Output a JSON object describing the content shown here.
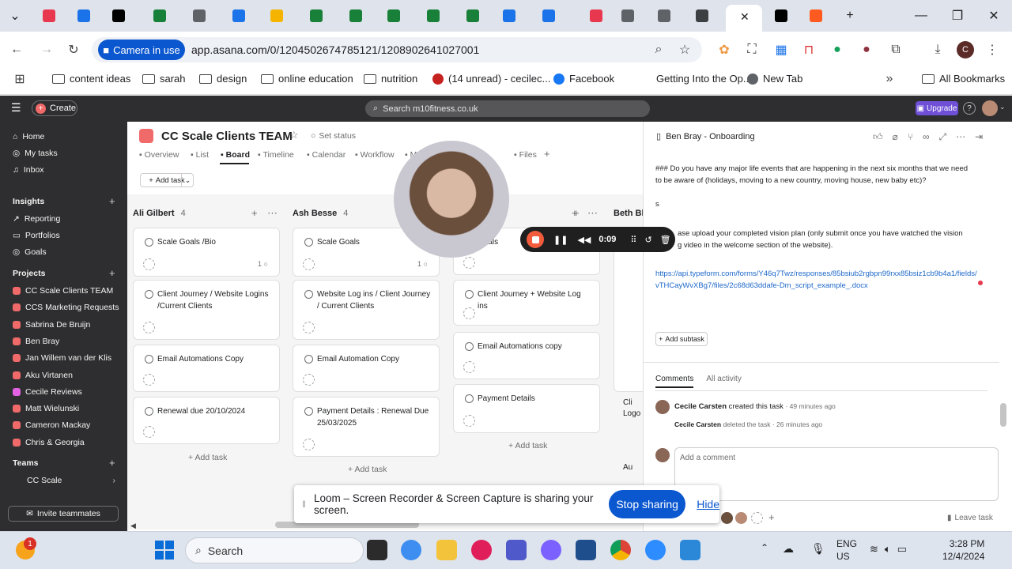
{
  "browser": {
    "url": "app.asana.com/0/1204502674785121/1208902641027001",
    "camera_label": "Camera in use",
    "bookmarks": [
      "content ideas",
      "sarah",
      "design",
      "online education",
      "nutrition",
      "(14 unread) - cecilec...",
      "Facebook",
      "Getting Into the Op...",
      "New Tab"
    ],
    "all_bookmarks": "All Bookmarks"
  },
  "asana": {
    "create_label": "Create",
    "search_placeholder": "Search m10fitness.co.uk",
    "upgrade_label": "Upgrade",
    "help_label": "?"
  },
  "sidebar": {
    "nav": [
      "Home",
      "My tasks",
      "Inbox"
    ],
    "insights_header": "Insights",
    "insights": [
      "Reporting",
      "Portfolios",
      "Goals"
    ],
    "projects_header": "Projects",
    "projects": [
      {
        "name": "CC Scale Clients TEAM",
        "color": "#f06a6a"
      },
      {
        "name": "CCS Marketing Requests",
        "color": "#f06a6a"
      },
      {
        "name": "Sabrina De Bruijn",
        "color": "#f06a6a"
      },
      {
        "name": "Ben Bray",
        "color": "#f06a6a"
      },
      {
        "name": "Jan Willem van der Klis",
        "color": "#f06a6a"
      },
      {
        "name": "Aku Virtanen",
        "color": "#f06a6a"
      },
      {
        "name": "Cecile Reviews",
        "color": "#e362e3"
      },
      {
        "name": "Matt Wielunski",
        "color": "#f06a6a"
      },
      {
        "name": "Cameron Mackay",
        "color": "#f06a6a"
      },
      {
        "name": "Chris & Georgia",
        "color": "#f06a6a"
      }
    ],
    "teams_header": "Teams",
    "teams": [
      "CC Scale"
    ],
    "invite_label": "Invite teammates"
  },
  "project": {
    "title": "CC Scale Clients TEAM",
    "status": "Set status",
    "tabs": [
      "Overview",
      "List",
      "Board",
      "Timeline",
      "Calendar",
      "Workflow",
      "Messages",
      "Files"
    ],
    "add_task": "Add task"
  },
  "board": {
    "columns": [
      {
        "name": "Ali Gilbert",
        "count": "4",
        "cards": [
          {
            "title": "Scale Goals /Bio",
            "comments": "1"
          },
          {
            "title": "Client Journey / Website Logins /Current Clients",
            "comments": ""
          },
          {
            "title": "Email Automations Copy",
            "comments": ""
          },
          {
            "title": "Renewal due 20/10/2024",
            "comments": ""
          }
        ]
      },
      {
        "name": "Ash Besse",
        "count": "4",
        "cards": [
          {
            "title": "Scale Goals",
            "comments": "1"
          },
          {
            "title": "Website Log ins / Client Journey / Current Clients",
            "comments": ""
          },
          {
            "title": "Email Automation Copy",
            "comments": ""
          },
          {
            "title": "Payment Details : Renewal Due 25/03/2025",
            "comments": ""
          }
        ]
      },
      {
        "name": "",
        "count": "",
        "cards": [
          {
            "title": "Goals",
            "comments": ""
          },
          {
            "title": "Client Journey + Website Log ins",
            "comments": ""
          },
          {
            "title": "Email Automations copy",
            "comments": ""
          },
          {
            "title": "Payment Details",
            "comments": ""
          }
        ]
      },
      {
        "name": "Beth Bla",
        "count": "",
        "cards": [
          {
            "title": "Cli",
            "comments": ""
          },
          {
            "title": "Logo",
            "comments": ""
          },
          {
            "title": "Au",
            "comments": ""
          }
        ]
      }
    ],
    "add_task": "Add task"
  },
  "detail": {
    "title": "Ben Bray - Onboarding",
    "question": "### Do you have any major life events that are happening in the next six months that we need to be aware of (holidays, moving to a new country, moving house, new baby etc)?",
    "answer": "s",
    "upload_text": "ase upload your completed vision plan (only submit once you have watched the vision",
    "upload_text2": "g video in the welcome section of the website).",
    "link": "https://api.typeform.com/forms/Y46q7Twz/responses/85bsiub2rgbpn99rxx85bsiz1cb9b4a1/fields/vTHCayWvXBg7/files/2c68d63ddafe-Dm_script_example_.docx",
    "add_subtask": "Add subtask",
    "comment_tabs": [
      "Comments",
      "All activity"
    ],
    "activity": [
      {
        "user": "Cecile Carsten",
        "text": "created this task",
        "time": "· 49 minutes ago"
      },
      {
        "user": "Cecile Carsten",
        "text": "deleted the task",
        "time": "· 26 minutes ago"
      }
    ],
    "comment_placeholder": "Add a comment",
    "leave_task": "Leave task"
  },
  "recorder": {
    "time": "0:09"
  },
  "loom": {
    "message": "Loom – Screen Recorder & Screen Capture is sharing your screen.",
    "stop_label": "Stop sharing",
    "hide_label": "Hide"
  },
  "taskbar": {
    "search_label": "Search",
    "lang": "ENG",
    "region": "US",
    "time": "3:28 PM",
    "date": "12/4/2024",
    "notification_count": "1"
  }
}
